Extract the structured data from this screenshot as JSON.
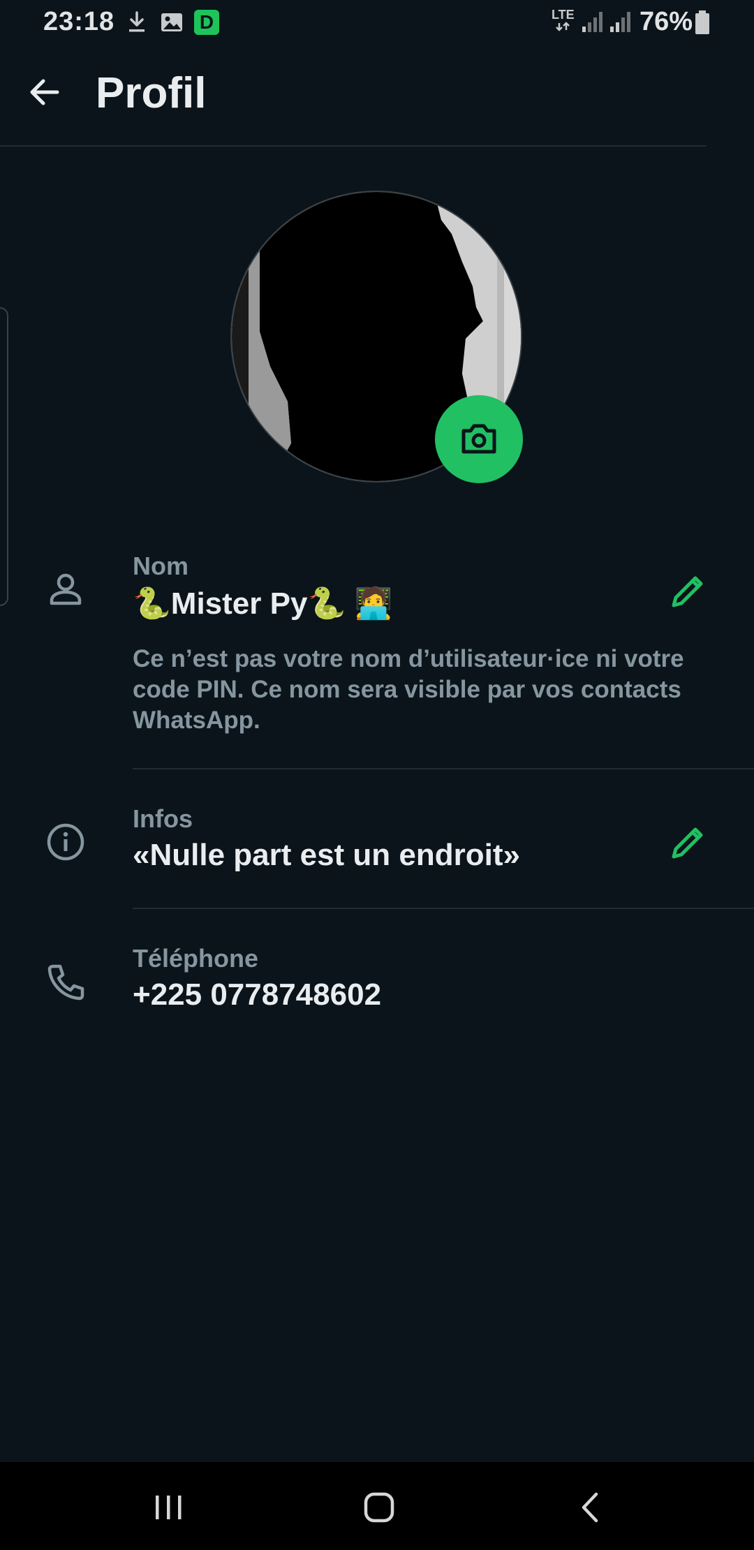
{
  "status_bar": {
    "time": "23:18",
    "notification_icons": [
      "download-icon",
      "image-icon",
      "app-d-icon"
    ],
    "app_badge_letter": "D",
    "network": "LTE",
    "battery": "76%"
  },
  "header": {
    "title": "Profil",
    "back_icon": "arrow-left-icon"
  },
  "profile": {
    "avatar": "profile-photo",
    "camera_icon": "camera-icon"
  },
  "name_section": {
    "label": "Nom",
    "value_parts": [
      "🐍",
      "Mister Py",
      "🐍",
      "🧑‍💻"
    ],
    "description": "Ce n’est pas votre nom d’utilisateur·ice ni votre code PIN. Ce nom sera visible par vos contacts WhatsApp.",
    "icon": "person-icon",
    "edit_icon": "pencil-icon"
  },
  "info_section": {
    "label": "Infos",
    "value": "«Nulle part est un endroit»",
    "icon": "info-icon",
    "edit_icon": "pencil-icon"
  },
  "phone_section": {
    "label": "Téléphone",
    "value": "+225 0778748602",
    "icon": "phone-icon"
  },
  "nav_bar": {
    "buttons": [
      "recent-apps-icon",
      "home-icon",
      "back-icon"
    ]
  },
  "colors": {
    "background": "#0b141a",
    "accent": "#21c063",
    "text_primary": "#e9edef",
    "text_secondary": "#8696a0",
    "divider": "#1f2c33"
  }
}
